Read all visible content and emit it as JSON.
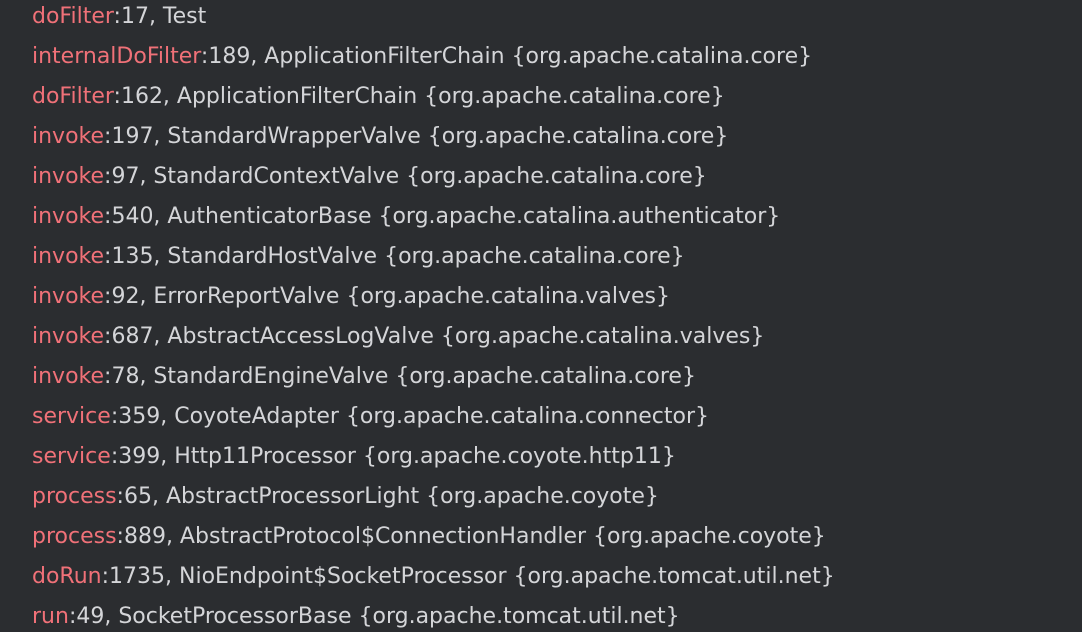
{
  "colors": {
    "background": "#2b2d30",
    "method": "#f07178",
    "text": "#d4d5d8"
  },
  "frames": [
    {
      "method": "doFilter",
      "details": ":17, Test"
    },
    {
      "method": "internalDoFilter",
      "details": ":189, ApplicationFilterChain {org.apache.catalina.core}"
    },
    {
      "method": "doFilter",
      "details": ":162, ApplicationFilterChain {org.apache.catalina.core}"
    },
    {
      "method": "invoke",
      "details": ":197, StandardWrapperValve {org.apache.catalina.core}"
    },
    {
      "method": "invoke",
      "details": ":97, StandardContextValve {org.apache.catalina.core}"
    },
    {
      "method": "invoke",
      "details": ":540, AuthenticatorBase {org.apache.catalina.authenticator}"
    },
    {
      "method": "invoke",
      "details": ":135, StandardHostValve {org.apache.catalina.core}"
    },
    {
      "method": "invoke",
      "details": ":92, ErrorReportValve {org.apache.catalina.valves}"
    },
    {
      "method": "invoke",
      "details": ":687, AbstractAccessLogValve {org.apache.catalina.valves}"
    },
    {
      "method": "invoke",
      "details": ":78, StandardEngineValve {org.apache.catalina.core}"
    },
    {
      "method": "service",
      "details": ":359, CoyoteAdapter {org.apache.catalina.connector}"
    },
    {
      "method": "service",
      "details": ":399, Http11Processor {org.apache.coyote.http11}"
    },
    {
      "method": "process",
      "details": ":65, AbstractProcessorLight {org.apache.coyote}"
    },
    {
      "method": "process",
      "details": ":889, AbstractProtocol$ConnectionHandler {org.apache.coyote}"
    },
    {
      "method": "doRun",
      "details": ":1735, NioEndpoint$SocketProcessor {org.apache.tomcat.util.net}"
    },
    {
      "method": "run",
      "details": ":49, SocketProcessorBase {org.apache.tomcat.util.net}"
    }
  ]
}
